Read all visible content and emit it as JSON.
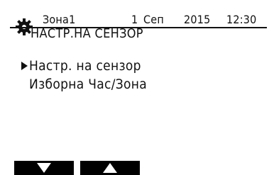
{
  "header": {
    "icon": "gear-icon",
    "zone": "Зона1",
    "date_day": "1",
    "date_month": "Сеп",
    "date_year": "2015",
    "time": "12:30",
    "title": "НАСТР.НА СЕНЗОР"
  },
  "menu": {
    "items": [
      {
        "label": "Настр. на сензор",
        "selected": true
      },
      {
        "label": "Изборна Час/Зона",
        "selected": false
      }
    ]
  },
  "softkeys": [
    {
      "icon": "arrow-down-icon"
    },
    {
      "icon": "arrow-up-icon"
    }
  ],
  "colors": {
    "background": "#ffffff",
    "foreground": "#111111",
    "softkey": "#000000"
  }
}
